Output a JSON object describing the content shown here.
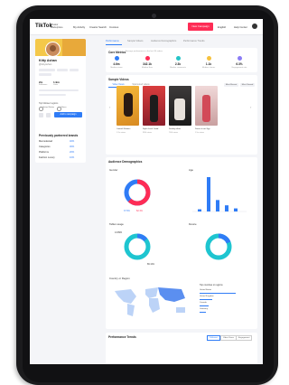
{
  "nav": {
    "logo": "TikTok",
    "logo_sub": "Creator Marketplace",
    "links": [
      "My Activity",
      "Creator Search",
      "Invoices"
    ],
    "cta": "New Campaign",
    "language": "English",
    "help": "Help Center"
  },
  "profile": {
    "name": "Kitty Ashan",
    "handle": "@kittyashan",
    "stats": [
      {
        "value": "2m",
        "label": "Followers"
      },
      {
        "value": "1.9m",
        "label": "Likes"
      }
    ],
    "audience_label": "Top follower regions",
    "radios": [
      "United States",
      "Others"
    ],
    "add_button": "Add to campaign"
  },
  "brands": {
    "title": "Previously partnered brands",
    "items": [
      {
        "name": "Mercedes/ad",
        "value": "40%"
      },
      {
        "name": "Categories",
        "value": "30%"
      },
      {
        "name": "Platforms",
        "value": "20%"
      },
      {
        "name": "Fashion Luxury",
        "value": "10%"
      }
    ]
  },
  "tabs": [
    "Performance",
    "Sample Videos",
    "Audience Demographics",
    "Performance Trends"
  ],
  "core_metrics": {
    "title": "Core Metrics",
    "subtitle": "Average performance in the last 30 videos",
    "items": [
      {
        "value": "4.6m",
        "label": "Median views",
        "color": "#2f7cf6"
      },
      {
        "value": "342.1k",
        "label": "Median likes",
        "color": "#fe2c55"
      },
      {
        "value": "2.3k",
        "label": "Median comments",
        "color": "#25c4c7"
      },
      {
        "value": "1.1k",
        "label": "Median shares",
        "color": "#f6c23e"
      },
      {
        "value": "6.3%",
        "label": "Engagement rate",
        "color": "#8b7cf6"
      }
    ]
  },
  "sample_videos": {
    "title": "Sample Videos",
    "segments": [
      "Video Views",
      "Sponsored videos"
    ],
    "pills": [
      "Most Recent",
      "Most Viewed"
    ],
    "videos": [
      {
        "caption": "#mood #flowers",
        "stats": "1.2m views"
      },
      {
        "caption": "Style check #ootd",
        "stats": "980k views"
      },
      {
        "caption": "Sunday vibes",
        "stats": "760k views"
      },
      {
        "caption": "Dance it out #fyp",
        "stats": "1.5m views"
      }
    ]
  },
  "audience": {
    "title": "Audience Demographics",
    "gender": {
      "title": "Gender",
      "female": "62.1%",
      "male": "37.9%"
    },
    "age": {
      "title": "Age",
      "values": [
        5,
        78,
        26,
        14,
        7
      ]
    },
    "device": {
      "title": "Tablet usage",
      "a": "13.89%",
      "b": "86.11%"
    },
    "device2": {
      "title": "Device"
    },
    "country": {
      "title": "Country or Region",
      "list_title": "Top countries or regions",
      "rows": [
        "United States",
        "United Kingdom",
        "Canada",
        "Germany"
      ]
    }
  },
  "performance": {
    "title": "Performance Trends",
    "tabs": [
      "Followers",
      "Video Views",
      "Engagement"
    ]
  }
}
